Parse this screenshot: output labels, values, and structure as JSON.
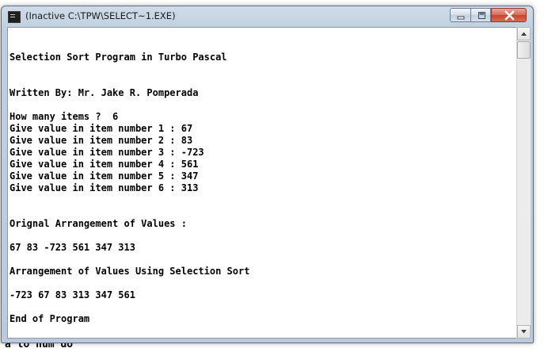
{
  "window": {
    "title": "(Inactive C:\\TPW\\SELECT~1.EXE)"
  },
  "console": {
    "lines": [
      "",
      "Selection Sort Program in Turbo Pascal",
      "",
      "",
      "Written By: Mr. Jake R. Pomperada",
      "",
      "How many items ?  6",
      "Give value in item number 1 : 67",
      "Give value in item number 2 : 83",
      "Give value in item number 3 : -723",
      "Give value in item number 4 : 561",
      "Give value in item number 5 : 347",
      "Give value in item number 6 : 313",
      "",
      "",
      "Orignal Arrangement of Values :",
      "",
      "67 83 -723 561 347 313",
      "",
      "Arrangement of Values Using Selection Sort",
      "",
      "-723 67 83 313 347 561",
      "",
      "End of Program"
    ]
  },
  "background_editor": {
    "bottom_line": "a to num do"
  },
  "icons": {
    "app": "console-app-icon",
    "minimize": "minimize-icon",
    "maximize": "maximize-icon",
    "close": "close-icon",
    "scroll_up": "scroll-up-arrow-icon",
    "scroll_down": "scroll-down-arrow-icon"
  },
  "colors": {
    "close_button": "#c4432d",
    "console_background": "#ffffff",
    "console_text": "#000000"
  }
}
